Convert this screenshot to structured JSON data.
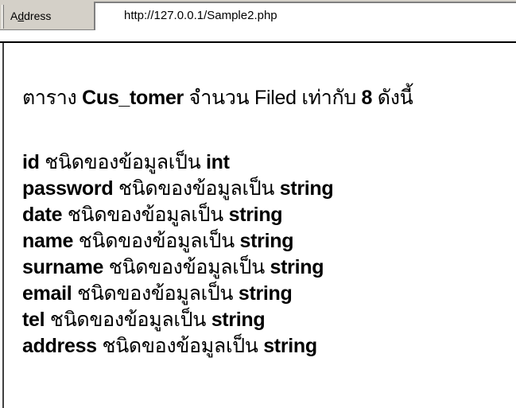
{
  "address_bar": {
    "label_prefix": "A",
    "label_underlined": "d",
    "label_suffix": "dress",
    "url": "http://127.0.0.1/Sample2.php"
  },
  "content": {
    "heading": {
      "prefix": "ตาราง ",
      "table_name": "Cus_tomer",
      "middle": " จำนวน Filed เท่ากับ ",
      "count": "8",
      "suffix": " ดังนี้"
    },
    "type_phrase": " ชนิดของข้อมูลเป็น ",
    "fields": [
      {
        "name": "id",
        "type": "int"
      },
      {
        "name": "password",
        "type": "string"
      },
      {
        "name": "date",
        "type": "string"
      },
      {
        "name": "name",
        "type": "string"
      },
      {
        "name": "surname",
        "type": "string"
      },
      {
        "name": "email",
        "type": "string"
      },
      {
        "name": "tel",
        "type": "string"
      },
      {
        "name": "address",
        "type": "string"
      }
    ]
  }
}
